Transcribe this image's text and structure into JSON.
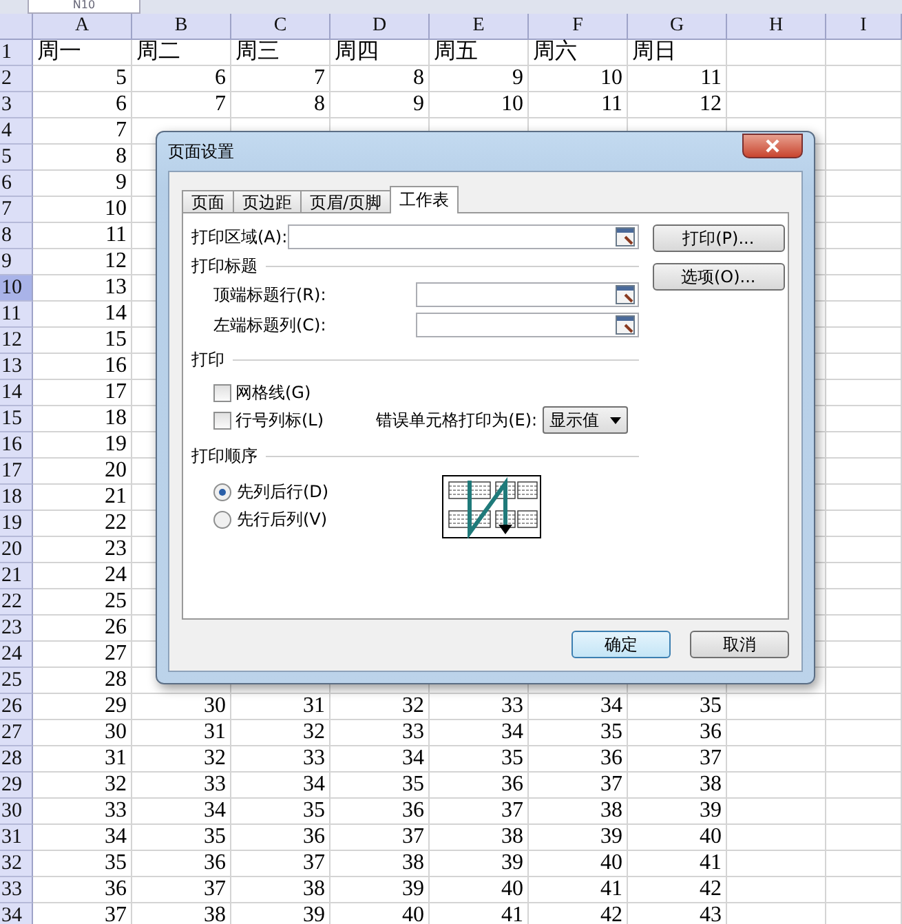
{
  "name_box": "N10",
  "columns": [
    "A",
    "B",
    "C",
    "D",
    "E",
    "F",
    "G",
    "H",
    "I"
  ],
  "rows": [
    {
      "header": "1",
      "active": false,
      "cells": [
        "周一",
        "周二",
        "周三",
        "周四",
        "周五",
        "周六",
        "周日"
      ]
    },
    {
      "header": "2",
      "active": false,
      "cells": [
        "5",
        "6",
        "7",
        "8",
        "9",
        "10",
        "11"
      ]
    },
    {
      "header": "3",
      "active": false,
      "cells": [
        "6",
        "7",
        "8",
        "9",
        "10",
        "11",
        "12"
      ]
    },
    {
      "header": "4",
      "active": false,
      "cells": [
        "7"
      ]
    },
    {
      "header": "5",
      "active": false,
      "cells": [
        "8"
      ]
    },
    {
      "header": "6",
      "active": false,
      "cells": [
        "9"
      ]
    },
    {
      "header": "7",
      "active": false,
      "cells": [
        "10"
      ]
    },
    {
      "header": "8",
      "active": false,
      "cells": [
        "11"
      ]
    },
    {
      "header": "9",
      "active": false,
      "cells": [
        "12"
      ]
    },
    {
      "header": "10",
      "active": true,
      "cells": [
        "13"
      ]
    },
    {
      "header": "11",
      "active": false,
      "cells": [
        "14"
      ]
    },
    {
      "header": "12",
      "active": false,
      "cells": [
        "15"
      ]
    },
    {
      "header": "13",
      "active": false,
      "cells": [
        "16"
      ]
    },
    {
      "header": "14",
      "active": false,
      "cells": [
        "17"
      ]
    },
    {
      "header": "15",
      "active": false,
      "cells": [
        "18"
      ]
    },
    {
      "header": "16",
      "active": false,
      "cells": [
        "19"
      ]
    },
    {
      "header": "17",
      "active": false,
      "cells": [
        "20"
      ]
    },
    {
      "header": "18",
      "active": false,
      "cells": [
        "21"
      ]
    },
    {
      "header": "19",
      "active": false,
      "cells": [
        "22"
      ]
    },
    {
      "header": "20",
      "active": false,
      "cells": [
        "23"
      ]
    },
    {
      "header": "21",
      "active": false,
      "cells": [
        "24"
      ]
    },
    {
      "header": "22",
      "active": false,
      "cells": [
        "25"
      ]
    },
    {
      "header": "23",
      "active": false,
      "cells": [
        "26"
      ]
    },
    {
      "header": "24",
      "active": false,
      "cells": [
        "27"
      ]
    },
    {
      "header": "25",
      "active": false,
      "cells": [
        "28"
      ]
    },
    {
      "header": "26",
      "active": false,
      "cells": [
        "29",
        "30",
        "31",
        "32",
        "33",
        "34",
        "35"
      ]
    },
    {
      "header": "27",
      "active": false,
      "cells": [
        "30",
        "31",
        "32",
        "33",
        "34",
        "35",
        "36"
      ]
    },
    {
      "header": "28",
      "active": false,
      "cells": [
        "31",
        "32",
        "33",
        "34",
        "35",
        "36",
        "37"
      ]
    },
    {
      "header": "29",
      "active": false,
      "cells": [
        "32",
        "33",
        "34",
        "35",
        "36",
        "37",
        "38"
      ]
    },
    {
      "header": "30",
      "active": false,
      "cells": [
        "33",
        "34",
        "35",
        "36",
        "37",
        "38",
        "39"
      ]
    },
    {
      "header": "31",
      "active": false,
      "cells": [
        "34",
        "35",
        "36",
        "37",
        "38",
        "39",
        "40"
      ]
    },
    {
      "header": "32",
      "active": false,
      "cells": [
        "35",
        "36",
        "37",
        "38",
        "39",
        "40",
        "41"
      ]
    },
    {
      "header": "33",
      "active": false,
      "cells": [
        "36",
        "37",
        "38",
        "39",
        "40",
        "41",
        "42"
      ]
    },
    {
      "header": "34",
      "active": false,
      "cells": [
        "37",
        "38",
        "39",
        "40",
        "41",
        "42",
        "43"
      ]
    }
  ],
  "dialog": {
    "title": "页面设置",
    "tabs": [
      {
        "label": "页面",
        "selected": false
      },
      {
        "label": "页边距",
        "selected": false
      },
      {
        "label": "页眉/页脚",
        "selected": false
      },
      {
        "label": "工作表",
        "selected": true
      }
    ],
    "print_area": {
      "label": "打印区域(A):"
    },
    "print_titles": {
      "heading": "打印标题",
      "fields": [
        {
          "label": "顶端标题行(R):"
        },
        {
          "label": "左端标题列(C):"
        }
      ]
    },
    "print": {
      "heading": "打印",
      "checkboxes": [
        {
          "label": "网格线(G)",
          "checked": false
        },
        {
          "label": "行号列标(L)",
          "checked": false
        }
      ],
      "error_label": "错误单元格打印为(E):",
      "error_value": "显示值"
    },
    "order": {
      "heading": "打印顺序",
      "options": [
        {
          "label": "先列后行(D)",
          "selected": true
        },
        {
          "label": "先行后列(V)",
          "selected": false
        }
      ]
    },
    "side_buttons": [
      "打印(P)...",
      "选项(O)..."
    ],
    "buttons": [
      {
        "label": "确定",
        "kind": "default"
      },
      {
        "label": "取消",
        "kind": "normal"
      }
    ]
  }
}
